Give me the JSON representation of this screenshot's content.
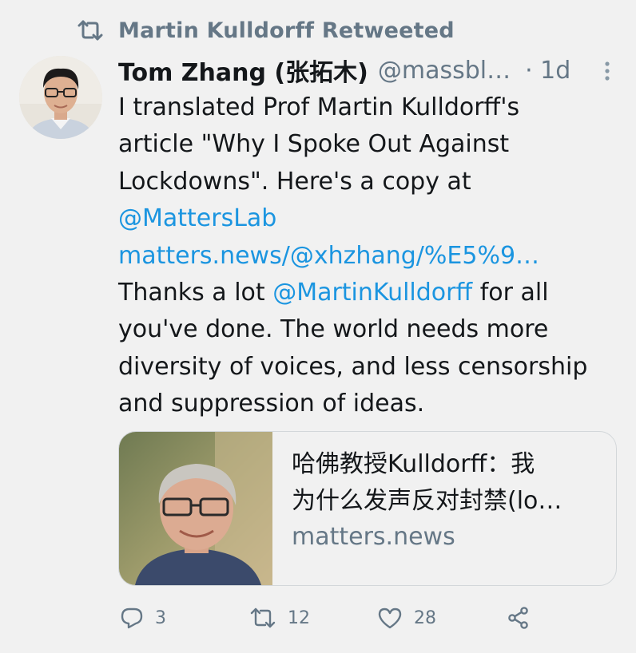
{
  "retweet_header": {
    "icon": "retweet-icon",
    "text": "Martin Kulldorff Retweeted"
  },
  "author": {
    "display_name": "Tom Zhang (张拓木)",
    "handle": "@massbl…",
    "time": "· 1d",
    "avatar": "avatar"
  },
  "tweet": {
    "lines": {
      "l1": "I translated Prof Martin Kulldorff's",
      "l2": "article \"Why I Spoke Out Against",
      "l3": "Lockdowns\". Here's a copy at",
      "l4_link": "@MattersLab",
      "l5_link": "matters.news/@xhzhang/%E5%9…",
      "l6_pre": "Thanks a lot ",
      "l6_link": "@MartinKulldorff",
      "l6_post": " for all",
      "l7": "you've done. The world needs more",
      "l8": "diversity of voices, and less censorship",
      "l9": "and suppression of ideas."
    },
    "link_color": "#1b95e0"
  },
  "card": {
    "title_line1": "哈佛教授Kulldorff：我",
    "title_line2": "为什么发声反对封禁(lo…",
    "domain": "matters.news"
  },
  "actions": {
    "reply": {
      "icon": "reply-icon",
      "count": "3"
    },
    "retweet": {
      "icon": "retweet-icon",
      "count": "12"
    },
    "like": {
      "icon": "heart-icon",
      "count": "28"
    },
    "share": {
      "icon": "share-icon"
    }
  }
}
